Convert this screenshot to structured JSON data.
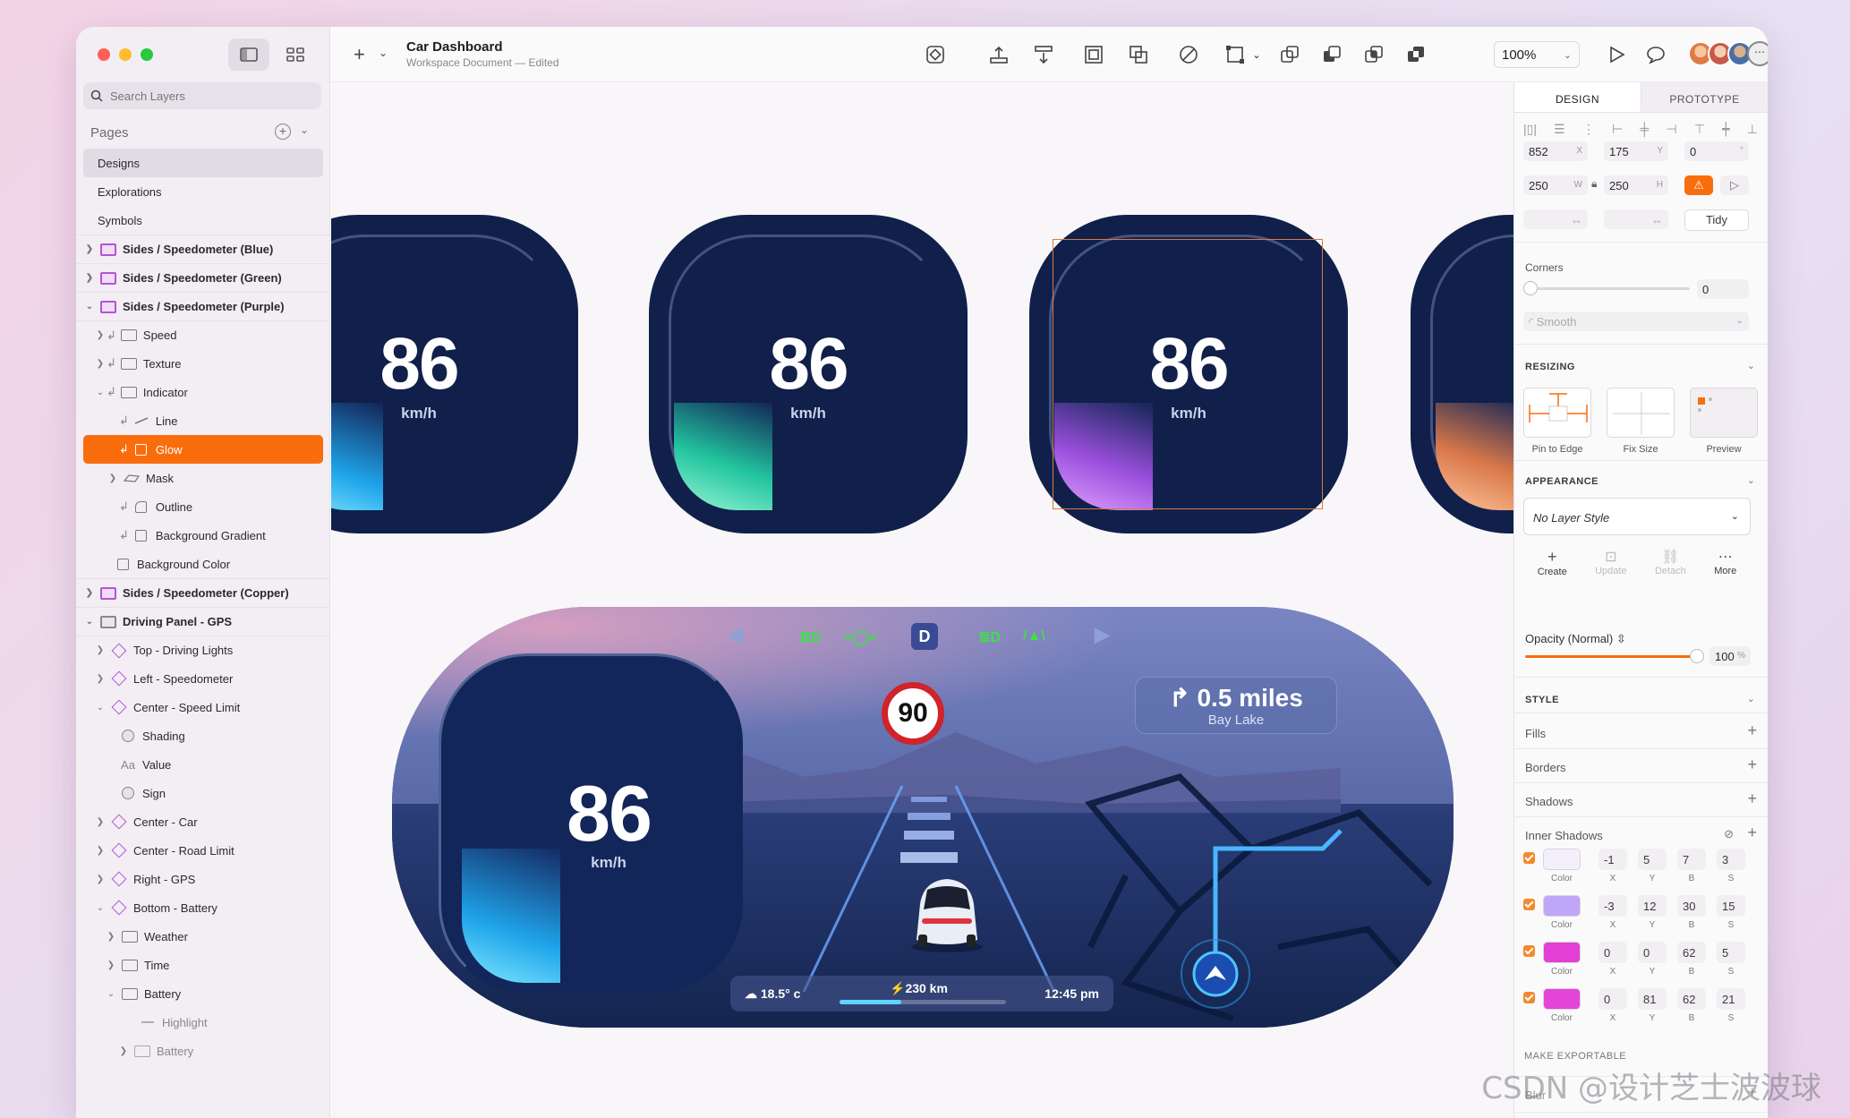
{
  "document": {
    "title": "Car Dashboard",
    "subtitle": "Workspace Document — Edited"
  },
  "sidebar": {
    "search_placeholder": "Search Layers",
    "pages_header": "Pages",
    "pages": [
      "Designs",
      "Explorations",
      "Symbols"
    ],
    "layers": [
      {
        "label": "Sides / Speedometer (Blue)",
        "type": "artboard"
      },
      {
        "label": "Sides / Speedometer (Green)",
        "type": "artboard"
      },
      {
        "label": "Sides / Speedometer (Purple)",
        "type": "artboard"
      },
      {
        "label": "Speed",
        "type": "folder"
      },
      {
        "label": "Texture",
        "type": "folder"
      },
      {
        "label": "Indicator",
        "type": "folder"
      },
      {
        "label": "Line",
        "type": "line"
      },
      {
        "label": "Glow",
        "type": "shape"
      },
      {
        "label": "Mask",
        "type": "mask"
      },
      {
        "label": "Outline",
        "type": "shape"
      },
      {
        "label": "Background Gradient",
        "type": "shape"
      },
      {
        "label": "Background Color",
        "type": "shape"
      },
      {
        "label": "Sides / Speedometer (Copper)",
        "type": "artboard"
      },
      {
        "label": "Driving Panel - GPS",
        "type": "artboard"
      },
      {
        "label": "Top - Driving Lights",
        "type": "symbol"
      },
      {
        "label": "Left - Speedometer",
        "type": "symbol"
      },
      {
        "label": "Center - Speed Limit",
        "type": "symbol"
      },
      {
        "label": "Shading",
        "type": "circle"
      },
      {
        "label": "Value",
        "type": "text"
      },
      {
        "label": "Sign",
        "type": "circle"
      },
      {
        "label": "Center - Car",
        "type": "symbol"
      },
      {
        "label": "Center - Road Limit",
        "type": "symbol"
      },
      {
        "label": "Right - GPS",
        "type": "symbol"
      },
      {
        "label": "Bottom - Battery",
        "type": "symbol"
      },
      {
        "label": "Weather",
        "type": "folder"
      },
      {
        "label": "Time",
        "type": "folder"
      },
      {
        "label": "Battery",
        "type": "folder"
      },
      {
        "label": "Highlight",
        "type": "line"
      },
      {
        "label": "Battery",
        "type": "folder"
      }
    ],
    "text_icon": "Aa"
  },
  "toolbar": {
    "zoom": "100%"
  },
  "canvas": {
    "speedometer": {
      "value": "86",
      "unit": "km/h"
    },
    "panel": {
      "speed": "86",
      "unit": "km/h",
      "gear": "D",
      "speed_limit": "90",
      "nav_distance": "0.5 miles",
      "nav_place": "Bay Lake",
      "temperature": "18.5° c",
      "range": "230 km",
      "range_fraction": 0.37,
      "time": "12:45 pm"
    }
  },
  "inspector": {
    "tabs": [
      "DESIGN",
      "PROTOTYPE"
    ],
    "x": "852",
    "x_label": "X",
    "y": "175",
    "y_label": "Y",
    "rotation": "0",
    "rotation_label": "°",
    "w": "250",
    "w_label": "W",
    "h": "250",
    "h_label": "H",
    "tidy": "Tidy",
    "corners_label": "Corners",
    "corners_value": "0",
    "corner_style": "Smooth",
    "resizing_header": "RESIZING",
    "resizing_options": [
      "Pin to Edge",
      "Fix Size",
      "Preview"
    ],
    "appearance_header": "APPEARANCE",
    "layer_style": "No Layer Style",
    "style_actions": [
      "Create",
      "Update",
      "Detach",
      "More"
    ],
    "opacity_label": "Opacity (Normal)",
    "opacity_value": "100",
    "opacity_unit": "%",
    "style_header": "STYLE",
    "fills": "Fills",
    "borders": "Borders",
    "shadows": "Shadows",
    "inner_shadows": "Inner Shadows",
    "shadow_labels": [
      "Color",
      "X",
      "Y",
      "B",
      "S"
    ],
    "inner_shadow_rows": [
      {
        "color": "#f4effd",
        "x": "-1",
        "y": "5",
        "b": "7",
        "s": "3"
      },
      {
        "color": "#c0a6f7",
        "x": "-3",
        "y": "12",
        "b": "30",
        "s": "15"
      },
      {
        "color": "#e33fd6",
        "x": "0",
        "y": "0",
        "b": "62",
        "s": "5"
      },
      {
        "color": "#e544d9",
        "x": "0",
        "y": "81",
        "b": "62",
        "s": "21"
      }
    ],
    "blur": "Blur",
    "make_exportable": "MAKE EXPORTABLE"
  },
  "watermark": "CSDN @设计芝士波波球",
  "colors": {
    "accent": "#f96d0d",
    "panel_dark": "#10204a",
    "glow_green": "#38e0b4",
    "glow_purple": "#b468e8",
    "glow_copper": "#e58a5a",
    "glow_blue": "#1fa4ea",
    "limit_red": "#d0232a"
  }
}
